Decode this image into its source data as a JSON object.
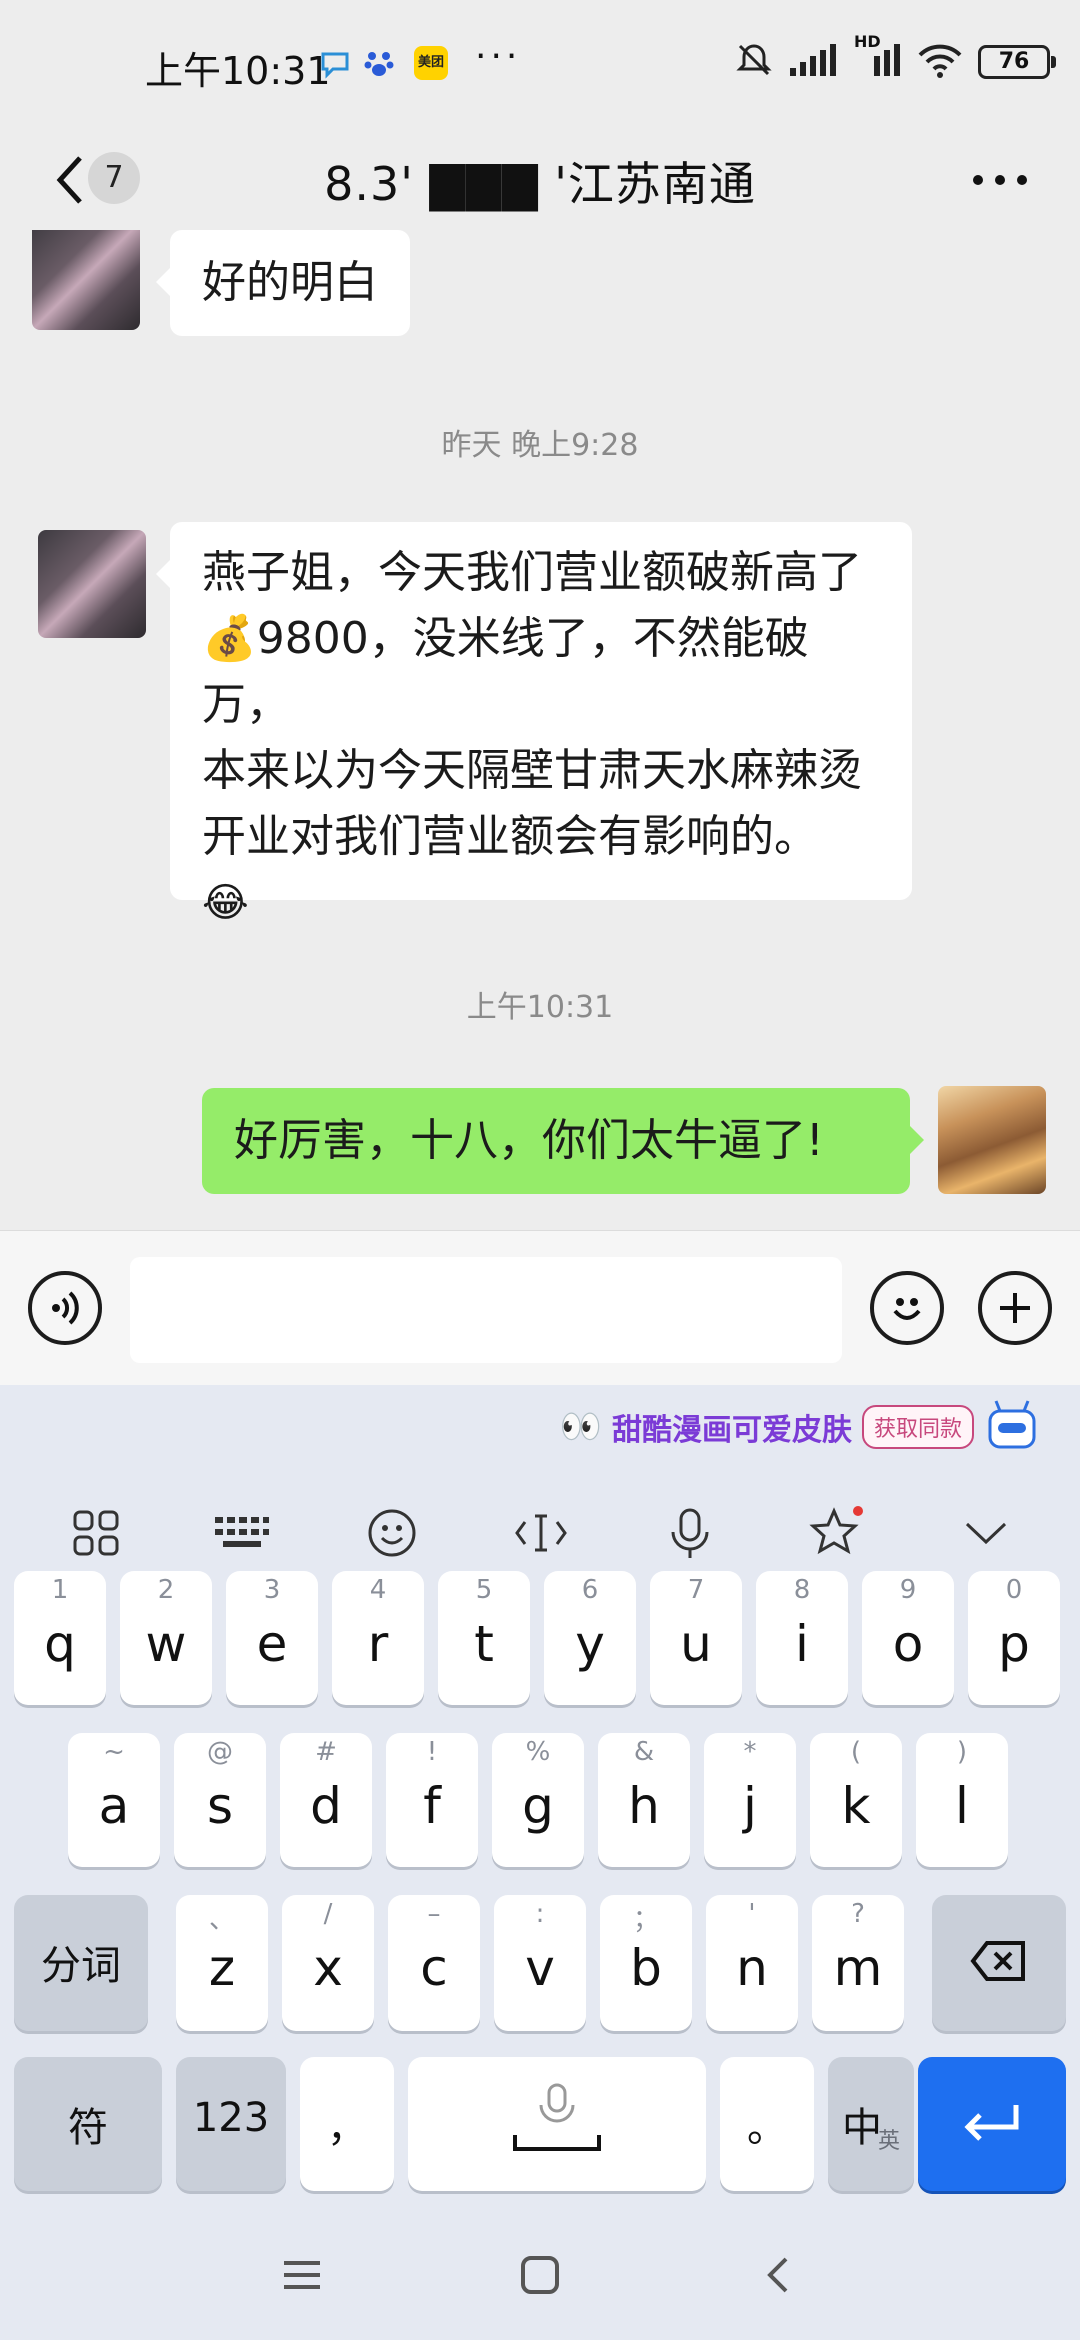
{
  "status_bar": {
    "time": "上午10:31",
    "app_icons": [
      "chat-bubble-icon",
      "baidu-paw-icon",
      "meituan-icon"
    ],
    "meituan_label": "美团",
    "dots": "···",
    "network_label": "HD",
    "battery": "76"
  },
  "header": {
    "unread_count": "7",
    "title": "8.3'  ▇▇▇  '江苏南通"
  },
  "messages": [
    {
      "side": "left",
      "text": "好的明白"
    },
    {
      "type": "time",
      "text": "昨天 晚上9:28"
    },
    {
      "side": "left",
      "lines": [
        "燕子姐，今天我们营业额破新高了",
        "💰9800，没米线了，不然能破万，",
        "本来以为今天隔壁甘肃天水麻辣烫",
        "开业对我们营业额会有影响的。",
        "😂"
      ]
    },
    {
      "type": "time",
      "text": "上午10:31"
    },
    {
      "side": "right",
      "text": "好厉害，十八，你们太牛逼了!"
    }
  ],
  "input": {
    "placeholder": ""
  },
  "keyboard": {
    "banner": {
      "title": "甜酷漫画可爱皮肤",
      "cta": "获取同款"
    },
    "row1": [
      {
        "hint": "1",
        "key": "q"
      },
      {
        "hint": "2",
        "key": "w"
      },
      {
        "hint": "3",
        "key": "e"
      },
      {
        "hint": "4",
        "key": "r"
      },
      {
        "hint": "5",
        "key": "t"
      },
      {
        "hint": "6",
        "key": "y"
      },
      {
        "hint": "7",
        "key": "u"
      },
      {
        "hint": "8",
        "key": "i"
      },
      {
        "hint": "9",
        "key": "o"
      },
      {
        "hint": "0",
        "key": "p"
      }
    ],
    "row2": [
      {
        "hint": "~",
        "key": "a"
      },
      {
        "hint": "@",
        "key": "s"
      },
      {
        "hint": "#",
        "key": "d"
      },
      {
        "hint": "!",
        "key": "f"
      },
      {
        "hint": "%",
        "key": "g"
      },
      {
        "hint": "&",
        "key": "h"
      },
      {
        "hint": "*",
        "key": "j"
      },
      {
        "hint": "(",
        "key": "k"
      },
      {
        "hint": ")",
        "key": "l"
      }
    ],
    "row3": [
      {
        "hint": "、",
        "key": "z"
      },
      {
        "hint": "/",
        "key": "x"
      },
      {
        "hint": "–",
        "key": "c"
      },
      {
        "hint": ":",
        "key": "v"
      },
      {
        "hint": "；",
        "key": "b"
      },
      {
        "hint": "'",
        "key": "n"
      },
      {
        "hint": "?",
        "key": "m"
      }
    ],
    "fenci": "分词",
    "symbols": "符",
    "numbers": "123",
    "comma": "，",
    "period": "。",
    "lang_main": "中",
    "lang_sub": "英"
  }
}
